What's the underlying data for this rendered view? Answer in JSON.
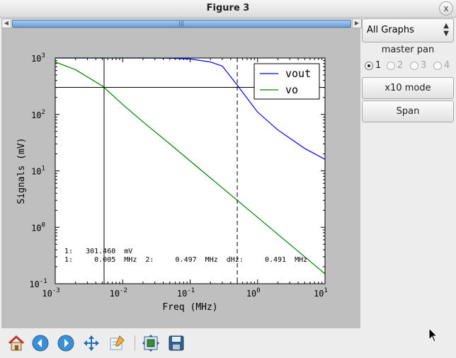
{
  "window": {
    "title": "Figure 3",
    "close_glyph": "x"
  },
  "scrollbar": {
    "left_arrow": "◀",
    "right_arrow": "▶",
    "grip": "|||"
  },
  "side_panel": {
    "combo_value": "All Graphs",
    "master_pan_label": "master pan",
    "radios": [
      {
        "label": "1",
        "selected": true,
        "enabled": true
      },
      {
        "label": "2",
        "selected": false,
        "enabled": false
      },
      {
        "label": "3",
        "selected": false,
        "enabled": false
      },
      {
        "label": "4",
        "selected": false,
        "enabled": false
      }
    ],
    "x10_label": "x10 mode",
    "span_label": "Span"
  },
  "toolbar": {
    "icons": [
      "home-icon",
      "back-icon",
      "forward-icon",
      "pan-icon",
      "zoom-icon",
      "subplots-icon",
      "save-icon"
    ]
  },
  "chart_data": {
    "type": "line",
    "xscale": "log",
    "yscale": "log",
    "xlim": [
      0.001,
      10
    ],
    "ylim": [
      0.1,
      1000
    ],
    "xlabel": "Freq (MHz)",
    "ylabel": "Signals (mV)",
    "xtick_labels": [
      {
        "base": "10",
        "exp": "-3"
      },
      {
        "base": "10",
        "exp": "-2"
      },
      {
        "base": "10",
        "exp": "-1"
      },
      {
        "base": "10",
        "exp": "0"
      },
      {
        "base": "10",
        "exp": "1"
      }
    ],
    "ytick_labels": [
      {
        "base": "10",
        "exp": "-1"
      },
      {
        "base": "10",
        "exp": "0"
      },
      {
        "base": "10",
        "exp": "1"
      },
      {
        "base": "10",
        "exp": "2"
      },
      {
        "base": "10",
        "exp": "3"
      }
    ],
    "legend_position": "top-right",
    "series": [
      {
        "name": "vout",
        "color": "#0000ff",
        "x": [
          0.001,
          0.002,
          0.005,
          0.01,
          0.02,
          0.05,
          0.1,
          0.2,
          0.3,
          0.5,
          1,
          2,
          5,
          10
        ],
        "y": [
          1000,
          1000,
          1000,
          1000,
          999,
          990,
          960,
          850,
          720,
          330,
          110,
          53,
          25,
          16
        ]
      },
      {
        "name": "vo",
        "color": "#008000",
        "x": [
          0.001,
          0.002,
          0.005,
          0.01,
          0.02,
          0.05,
          0.1,
          0.2,
          0.5,
          1,
          2,
          5,
          10
        ],
        "y": [
          850,
          620,
          320,
          150,
          74,
          30,
          15,
          7.5,
          3.0,
          1.5,
          0.75,
          0.3,
          0.15
        ]
      }
    ],
    "cursors": [
      {
        "axis": "x",
        "value": 0.0053,
        "style": "solid"
      },
      {
        "axis": "x",
        "value": 0.5,
        "style": "dashed"
      },
      {
        "axis": "y",
        "value": 301.46,
        "style": "solid"
      }
    ],
    "annotations": [
      "1:   301.460  mV",
      "1:     0.005  MHz  2:     0.497  MHz  dHz:     0.491  MHz"
    ]
  }
}
